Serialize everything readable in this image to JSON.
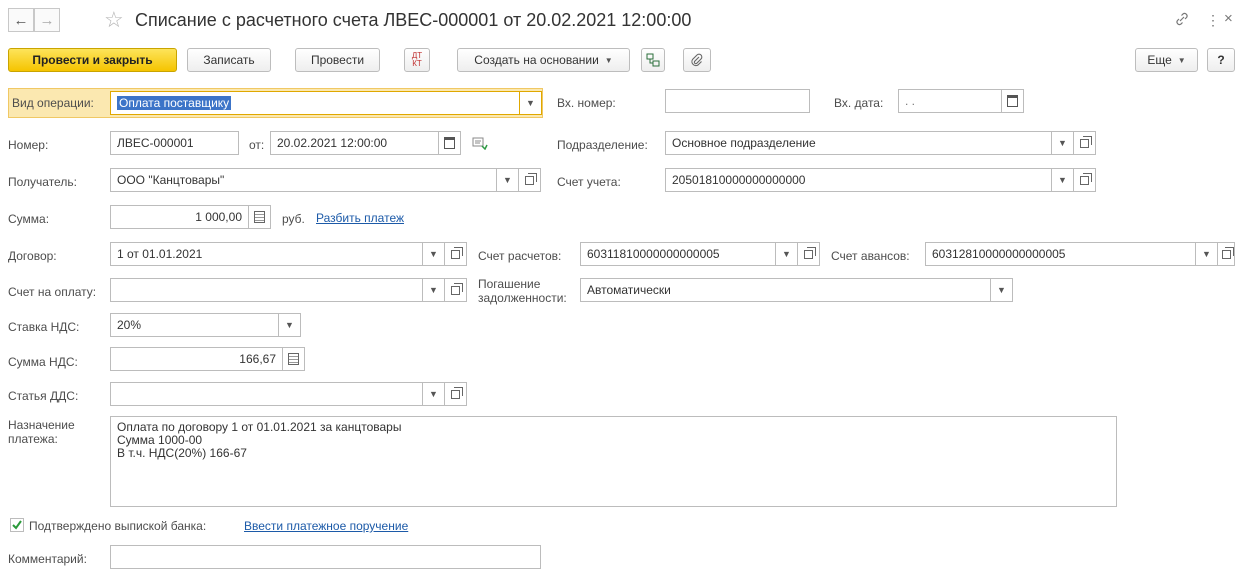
{
  "header": {
    "title": "Списание с расчетного счета ЛВЕС-000001 от 20.02.2021 12:00:00",
    "back_icon": "←",
    "forward_icon": "→",
    "star_icon": "☆",
    "link_icon": "🔗",
    "more_icon": "⋮",
    "close_icon": "×"
  },
  "toolbar": {
    "post_close": "Провести и закрыть",
    "save": "Записать",
    "post": "Провести",
    "dt_kt": "Дт/Кт",
    "create_based": "Создать на основании",
    "more": "Еще",
    "help": "?"
  },
  "form": {
    "operation_label": "Вид операции:",
    "operation_value": "Оплата поставщику",
    "in_number_label": "Вх. номер:",
    "in_number_value": "",
    "in_date_label": "Вх. дата:",
    "in_date_value": " .  .",
    "number_label": "Номер:",
    "number_value": "ЛВЕС-000001",
    "from_label": "от:",
    "date_value": "20.02.2021 12:00:00",
    "division_label": "Подразделение:",
    "division_value": "Основное подразделение",
    "recipient_label": "Получатель:",
    "recipient_value": "ООО \"Канцтовары\"",
    "account_label": "Счет учета:",
    "account_value": "20501810000000000000",
    "sum_label": "Сумма:",
    "sum_value": "1 000,00",
    "currency": "руб.",
    "split_link": "Разбить платеж",
    "contract_label": "Договор:",
    "contract_value": "1 от 01.01.2021",
    "settle_label": "Счет расчетов:",
    "settle_value": "60311810000000000005",
    "advance_label": "Счет авансов:",
    "advance_value": "60312810000000000005",
    "invoice_label": "Счет на оплату:",
    "invoice_value": "",
    "repay_label_1": "Погашение",
    "repay_label_2": "задолженности:",
    "repay_value": "Автоматически",
    "vat_rate_label": "Ставка НДС:",
    "vat_rate_value": "20%",
    "vat_sum_label": "Сумма НДС:",
    "vat_sum_value": "166,67",
    "dds_label": "Статья ДДС:",
    "dds_value": "",
    "purpose_label_1": "Назначение",
    "purpose_label_2": "платежа:",
    "purpose_value": "Оплата по договору 1 от 01.01.2021 за канцтовары\nСумма 1000-00\nВ т.ч. НДС(20%) 166-67",
    "confirmed_label": "Подтверждено выпиской банка:",
    "enter_order_link": "Ввести платежное поручение",
    "comment_label": "Комментарий:",
    "comment_value": ""
  }
}
